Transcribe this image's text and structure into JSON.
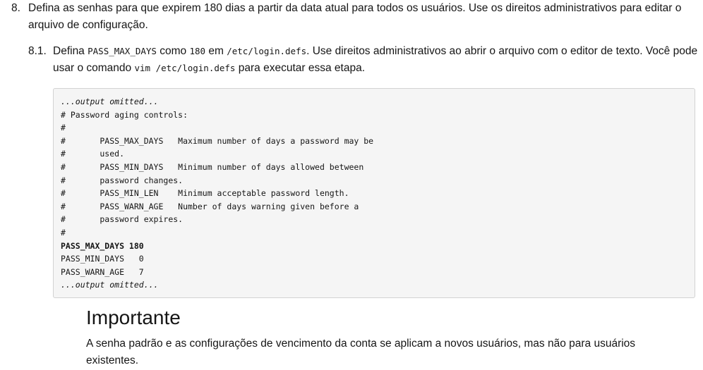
{
  "step": {
    "number": "8.",
    "text": "Defina as senhas para que expirem 180 dias a partir da data atual para todos os usuários. Use os direitos administrativos para editar o arquivo de configuração."
  },
  "substep": {
    "number": "8.1.",
    "t1": "Defina ",
    "c1": "PASS_MAX_DAYS",
    "t2": " como ",
    "c2": "180",
    "t3": " em ",
    "c3": "/etc/login.defs",
    "t4": ". Use direitos administrativos ao abrir o arquivo com o editor de texto. Você pode usar o comando ",
    "c4": "vim /etc/login.defs",
    "t5": " para executar essa etapa."
  },
  "code_lines": [
    "...output omitted...",
    "# Password aging controls:",
    "#",
    "#       PASS_MAX_DAYS   Maximum number of days a password may be",
    "#       used.",
    "#       PASS_MIN_DAYS   Minimum number of days allowed between",
    "#       password changes.",
    "#       PASS_MIN_LEN    Minimum acceptable password length.",
    "#       PASS_WARN_AGE   Number of days warning given before a",
    "#       password expires.",
    "#",
    "PASS_MAX_DAYS 180",
    "PASS_MIN_DAYS   0",
    "PASS_WARN_AGE   7",
    "...output omitted..."
  ],
  "note": {
    "title": "Importante",
    "text": "A senha padrão e as configurações de vencimento da conta se aplicam a novos usuários, mas não para usuários existentes."
  }
}
